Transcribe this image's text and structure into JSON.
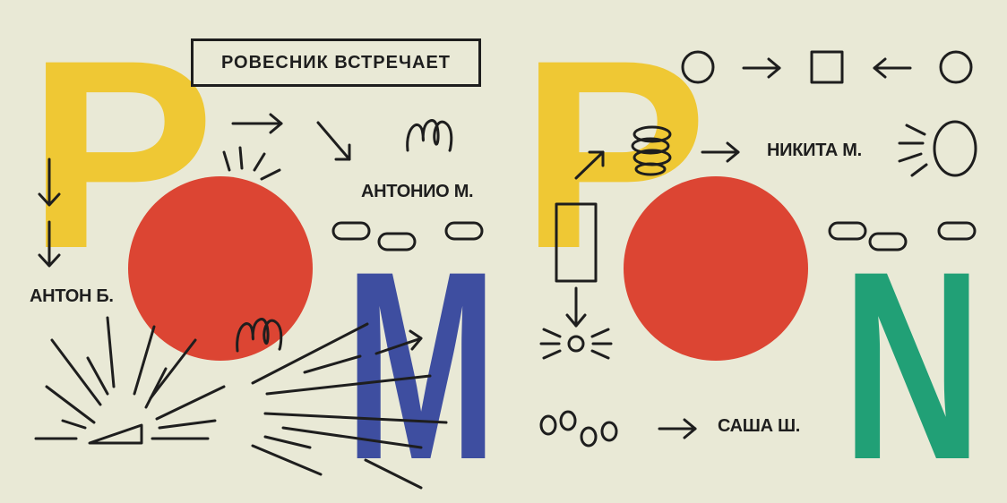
{
  "title": "РОВЕСНИК ВСТРЕЧАЕТ",
  "big_letters": {
    "p1": "P",
    "m": "M",
    "p2": "P",
    "n": "N"
  },
  "names": {
    "anton": "АНТОН Б.",
    "antonio": "АНТОНИО М.",
    "nikita": "НИКИТА М.",
    "sasha": "САША Ш."
  },
  "colors": {
    "background": "#e9e9d6",
    "yellow": "#efc834",
    "red": "#dc4533",
    "blue": "#3e4ea0",
    "green": "#21a076",
    "ink": "#1e1e1e"
  }
}
